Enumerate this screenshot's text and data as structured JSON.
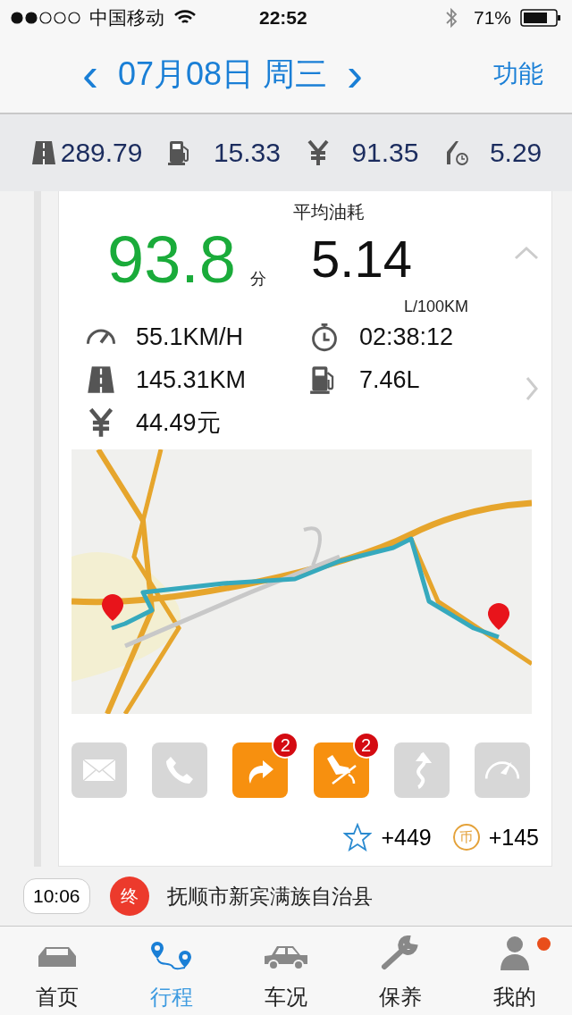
{
  "status_bar": {
    "carrier": "中国移动",
    "time": "22:52",
    "battery": "71%"
  },
  "nav": {
    "prev": "‹",
    "title": "07月08日 周三",
    "next": "›",
    "action": "功能"
  },
  "summary": [
    {
      "kind": "road",
      "value": "289.79"
    },
    {
      "kind": "fuel",
      "value": "15.33"
    },
    {
      "kind": "yen",
      "value": "91.35"
    },
    {
      "kind": "consumption",
      "value": "5.29"
    }
  ],
  "trip": {
    "score": "93.8",
    "score_unit": "分",
    "avg_label": "平均油耗",
    "avg_value": "5.14",
    "avg_unit": "L/100KM",
    "expanded": true,
    "details": [
      {
        "kind": "speed",
        "value": "55.1KM/H"
      },
      {
        "kind": "timer",
        "value": "02:38:12"
      },
      {
        "kind": "road",
        "value": "145.31KM"
      },
      {
        "kind": "fuel",
        "value": "7.46L"
      },
      {
        "kind": "yen",
        "value": "44.49元"
      }
    ],
    "events": [
      {
        "kind": "mail",
        "active": false
      },
      {
        "kind": "phone",
        "active": false
      },
      {
        "kind": "turn",
        "active": true,
        "badge": "2"
      },
      {
        "kind": "brake",
        "active": true,
        "badge": "2"
      },
      {
        "kind": "curve",
        "active": false
      },
      {
        "kind": "speed",
        "active": false
      }
    ],
    "rewards": {
      "stars": "+449",
      "coin_label": "币",
      "coins": "+145"
    }
  },
  "timeline": {
    "time": "10:06",
    "marker": "终",
    "place": "抚顺市新宾满族自治县"
  },
  "tabs": [
    {
      "kind": "home",
      "label": "首页",
      "selected": false,
      "dot": false
    },
    {
      "kind": "trip",
      "label": "行程",
      "selected": true,
      "dot": false
    },
    {
      "kind": "car",
      "label": "车况",
      "selected": false,
      "dot": false
    },
    {
      "kind": "service",
      "label": "保养",
      "selected": false,
      "dot": false
    },
    {
      "kind": "me",
      "label": "我的",
      "selected": false,
      "dot": true
    }
  ]
}
